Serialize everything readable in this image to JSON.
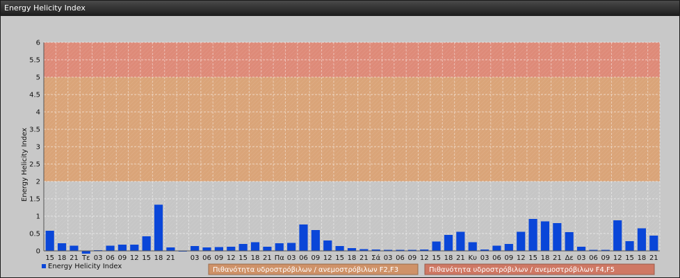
{
  "window": {
    "title": "Energy Helicity Index"
  },
  "legend": {
    "series_label": "Energy Helicity Index",
    "band1_label": "Πιθανότητα υδροστρόβιλων / ανεμοστρόβιλων F2,F3",
    "band2_label": "Πιθανότητα υδροστρόβιλων / ανεμοστρόβιλων F4,F5"
  },
  "colors": {
    "bar": "#0a46d8",
    "band_low": "#c6c6c6",
    "band_mid": "#daa478",
    "band_high": "#de8a78",
    "band1_legend": "#cf9268",
    "band2_legend": "#cf7864"
  },
  "chart_data": {
    "type": "bar",
    "ylabel": "Energy Helicity Index",
    "ylim": [
      0,
      6
    ],
    "yticks": [
      "0",
      "0.5",
      "1",
      "1.5",
      "2",
      "2.5",
      "3",
      "3.5",
      "4",
      "4.5",
      "5",
      "5.5",
      "6"
    ],
    "bands": [
      {
        "from": 0,
        "to": 2
      },
      {
        "from": 2,
        "to": 5
      },
      {
        "from": 5,
        "to": 6
      }
    ],
    "grid": true,
    "legend_position": "bottom",
    "categories": [
      "15",
      "18",
      "21",
      "Τε",
      "03",
      "06",
      "09",
      "12",
      "15",
      "18",
      "21",
      "",
      "03",
      "06",
      "09",
      "12",
      "15",
      "18",
      "21",
      "Πα",
      "03",
      "06",
      "09",
      "12",
      "15",
      "18",
      "21",
      "Σά",
      "03",
      "06",
      "09",
      "12",
      "15",
      "18",
      "21",
      "Κυ",
      "03",
      "06",
      "09",
      "12",
      "15",
      "18",
      "21",
      "Δε",
      "03",
      "06",
      "09",
      "12",
      "15",
      "18",
      "21"
    ],
    "values": [
      0.58,
      0.22,
      0.15,
      -0.08,
      0.02,
      0.15,
      0.18,
      0.18,
      0.42,
      1.33,
      0.1,
      -0.02,
      0.14,
      0.1,
      0.11,
      0.12,
      0.2,
      0.25,
      0.12,
      0.22,
      0.23,
      0.76,
      0.6,
      0.3,
      0.14,
      0.08,
      0.05,
      0.04,
      0.03,
      0.03,
      0.03,
      0.04,
      0.27,
      0.46,
      0.55,
      0.25,
      0.04,
      0.15,
      0.2,
      0.55,
      0.92,
      0.85,
      0.8,
      0.54,
      0.12,
      0.03,
      0.03,
      0.88,
      0.28,
      0.65,
      0.44
    ]
  }
}
